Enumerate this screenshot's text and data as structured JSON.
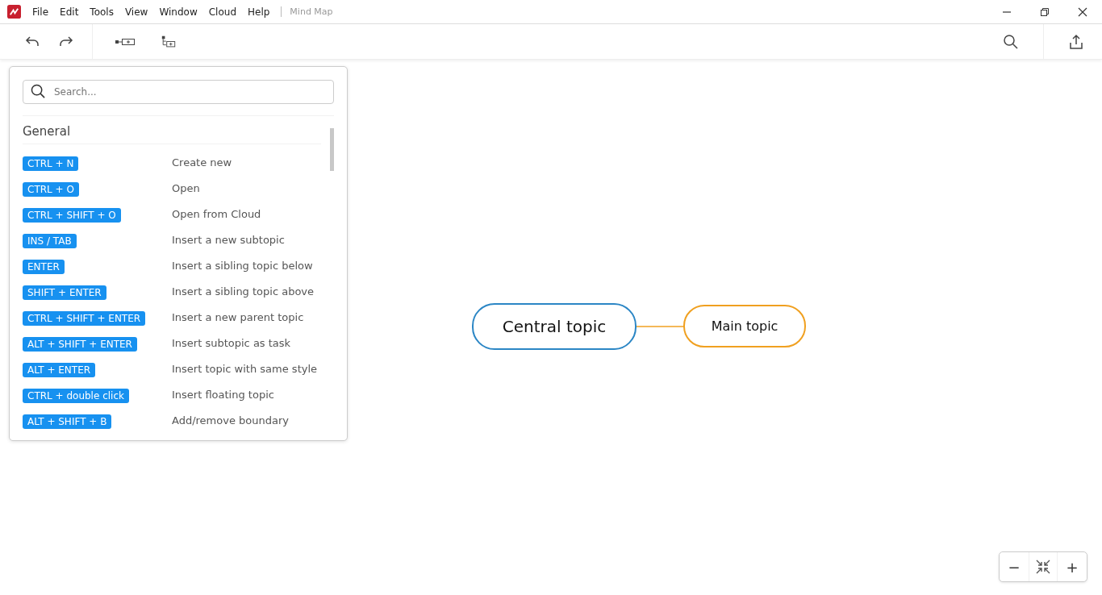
{
  "menu": [
    "File",
    "Edit",
    "Tools",
    "View",
    "Window",
    "Cloud",
    "Help"
  ],
  "document_title": "Mind Map",
  "shortcuts_panel": {
    "search": {
      "placeholder": "Search..."
    },
    "section": "General",
    "items": [
      {
        "keys": "CTRL + N",
        "action": "Create new"
      },
      {
        "keys": "CTRL + O",
        "action": "Open"
      },
      {
        "keys": "CTRL + SHIFT + O",
        "action": "Open from Cloud"
      },
      {
        "keys": "INS / TAB",
        "action": "Insert a new subtopic"
      },
      {
        "keys": "ENTER",
        "action": "Insert a sibling topic below"
      },
      {
        "keys": "SHIFT + ENTER",
        "action": "Insert a sibling topic above"
      },
      {
        "keys": "CTRL + SHIFT + ENTER",
        "action": "Insert a new parent topic"
      },
      {
        "keys": "ALT + SHIFT + ENTER",
        "action": "Insert subtopic as task"
      },
      {
        "keys": "ALT + ENTER",
        "action": "Insert topic with same style"
      },
      {
        "keys": "CTRL + double click",
        "action": "Insert floating topic"
      },
      {
        "keys": "ALT + SHIFT + B",
        "action": "Add/remove boundary"
      }
    ]
  },
  "mind_map": {
    "central_topic": "Central topic",
    "main_topic": "Main topic"
  },
  "zoom_controls": {
    "zoom_out": "−",
    "zoom_in": "+"
  }
}
